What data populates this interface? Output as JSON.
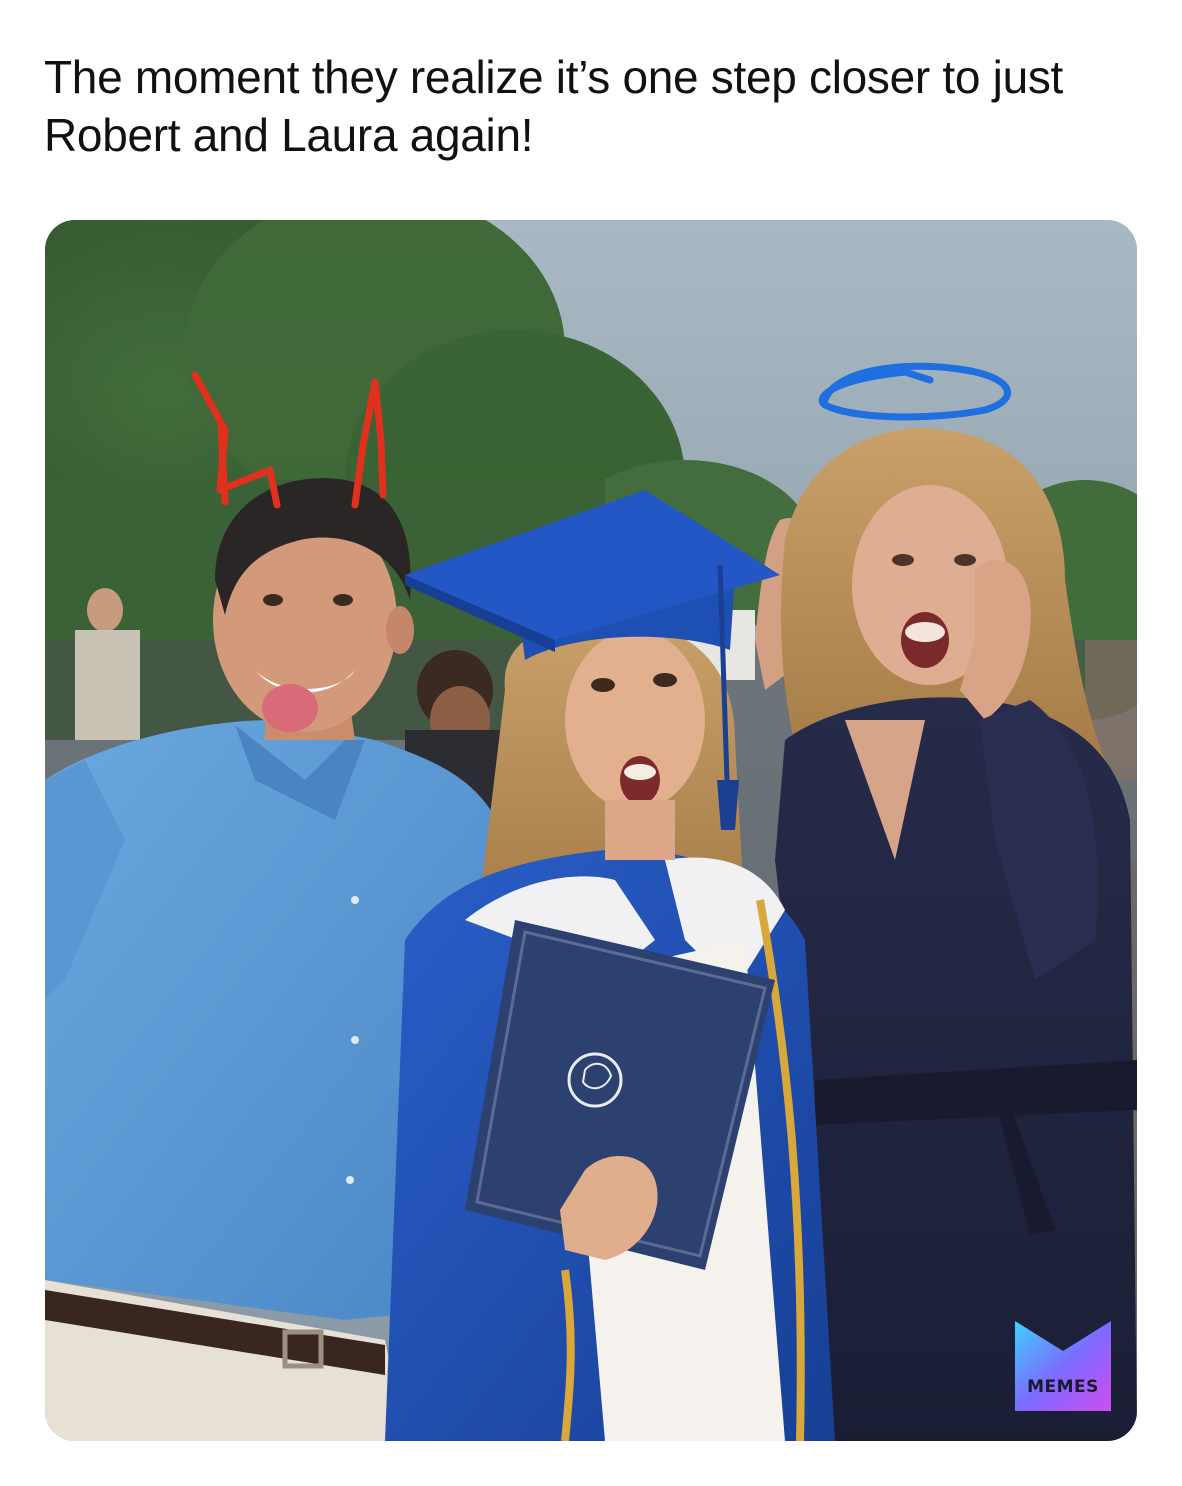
{
  "caption": "The moment they realize it’s one step closer to just Robert and Laura again!",
  "watermark": {
    "label": "MEMES",
    "icon": "memes-logo-icon"
  },
  "photo": {
    "subject": "graduation-photo",
    "colors": {
      "sky": "#9fb0bb",
      "trees": "#3f6b3a",
      "dad_shirt": "#5b9bd8",
      "gown": "#1e4fb3",
      "mom_dress": "#1f2340",
      "devil_horns": "#e0301e",
      "halo": "#1f6fe0"
    }
  }
}
